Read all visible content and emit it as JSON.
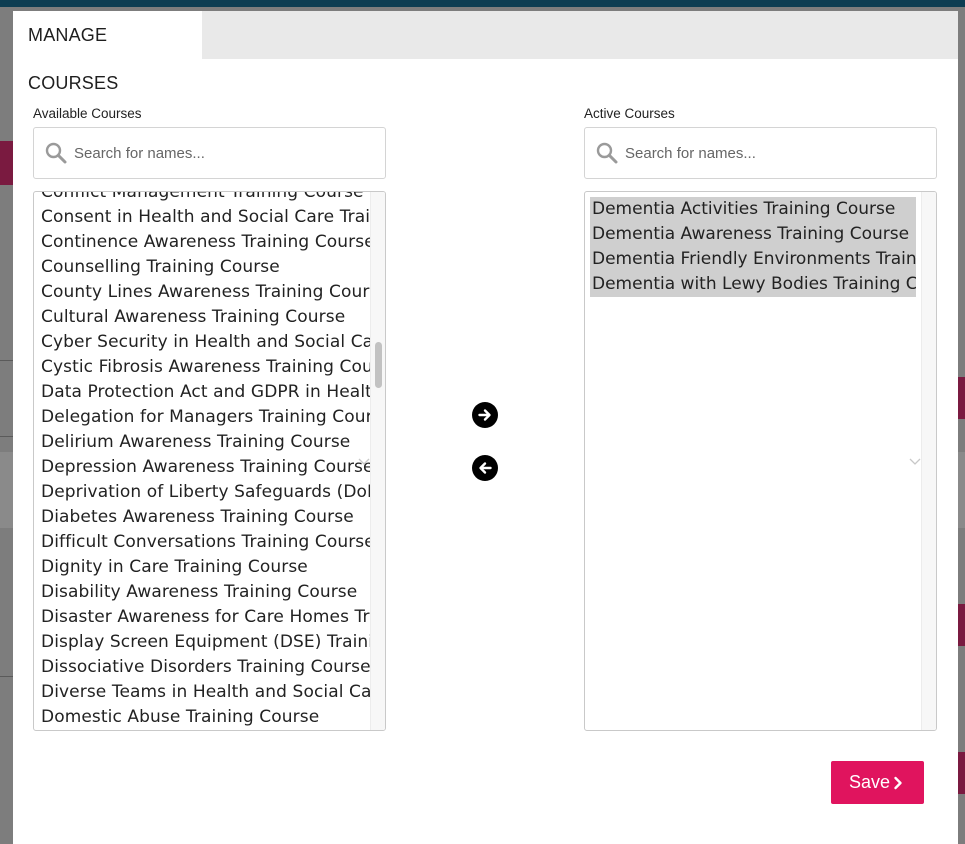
{
  "modal": {
    "tab_label": "MANAGE COURSES"
  },
  "available": {
    "label": "Available Courses",
    "search_placeholder": "Search for names...",
    "items": [
      "Conflict Management Training Course",
      "Consent in Health and Social Care Training Course",
      "Continence Awareness Training Course",
      "Counselling Training Course",
      "County Lines Awareness Training Course",
      "Cultural Awareness Training Course",
      "Cyber Security in Health and Social Care Training Course",
      "Cystic Fibrosis Awareness Training Course",
      "Data Protection Act and GDPR in Health and Social Care",
      "Delegation for Managers Training Course",
      "Delirium Awareness Training Course",
      "Depression Awareness Training Course",
      "Deprivation of Liberty Safeguards (DoLS) Training Course",
      "Diabetes Awareness Training Course",
      "Difficult Conversations Training Course",
      "Dignity in Care Training Course",
      "Disability Awareness Training Course",
      "Disaster Awareness for Care Homes Training Course",
      "Display Screen Equipment (DSE) Training Course",
      "Dissociative Disorders Training Course",
      "Diverse Teams in Health and Social Care",
      "Domestic Abuse Training Course"
    ]
  },
  "active": {
    "label": "Active Courses",
    "search_placeholder": "Search for names...",
    "items": [
      "Dementia Activities Training Course",
      "Dementia Awareness Training Course",
      "Dementia Friendly Environments Training Course",
      "Dementia with Lewy Bodies Training Course"
    ]
  },
  "actions": {
    "save_label": "Save",
    "move_right_icon": "arrow-right-icon",
    "move_left_icon": "arrow-left-icon"
  },
  "colors": {
    "accent": "#e0145e",
    "selected_bg": "#cfcfcf",
    "topbar": "#0d3d52"
  }
}
